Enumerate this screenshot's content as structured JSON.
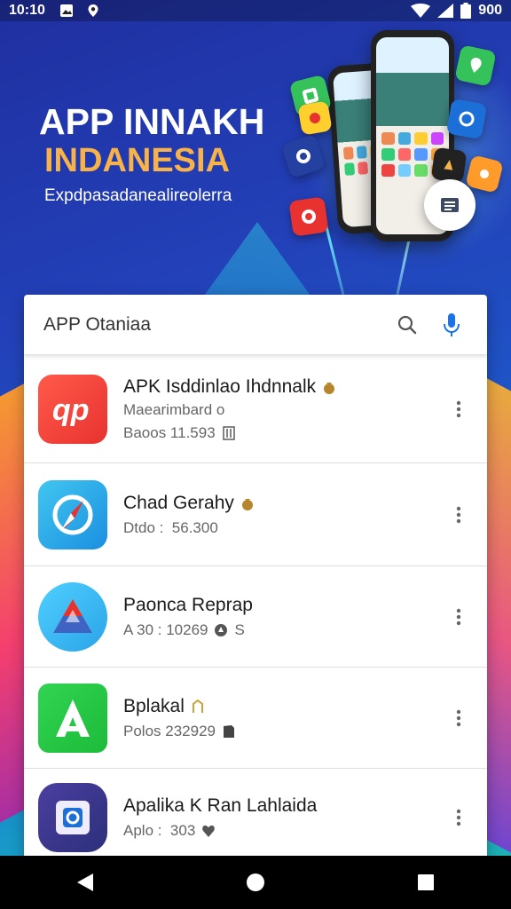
{
  "status_bar": {
    "time": "10:10",
    "battery": "900",
    "icons": [
      "gallery-icon",
      "location-icon",
      "wifi-icon",
      "signal-icon",
      "battery-icon"
    ]
  },
  "hero": {
    "title": "APP INNAKH",
    "subtitle": "INDANESIA",
    "tagline": "Expdpasadanealireolerra"
  },
  "search": {
    "placeholder": "APP Otaniaa"
  },
  "apps": [
    {
      "name": "APK Isddinlao Ihdnnalk",
      "developer": "Maearimbard o",
      "meta": "Baoos 11.593",
      "badge": "coin-bag",
      "meta_icon": "book-icon",
      "icon": "app-logo-red",
      "colors": [
        "#e8322f",
        "#ff5a4a"
      ]
    },
    {
      "name": "Chad Gerahy",
      "developer": "",
      "meta": "Dtdo :  56.300",
      "badge": "coin-bag",
      "meta_icon": "coin-bag",
      "icon": "compass-logo",
      "colors": [
        "#1b8fe0",
        "#41c6f0"
      ]
    },
    {
      "name": "Paonca Reprap",
      "developer": "",
      "meta": "A 30 : 10269",
      "badge": "",
      "meta_icon": "pin-icon",
      "meta_suffix": "S",
      "icon": "triangle-logo",
      "colors": [
        "#2aa3e8",
        "#4fd0ff"
      ]
    },
    {
      "name": "Bplakal",
      "developer": "",
      "meta": "Polos 232929",
      "badge": "gold-mark",
      "meta_icon": "book-icon",
      "icon": "letter-a-logo",
      "colors": [
        "#1dbb3a",
        "#31d452"
      ]
    },
    {
      "name": "Apalika K Ran Lahlaida",
      "developer": "",
      "meta": "Aplo :  303",
      "badge": "",
      "meta_icon": "heart-icon",
      "meta_prefix_icon": "coin-bag",
      "icon": "square-logo",
      "colors": [
        "#2c2f7a",
        "#4b3fa0"
      ]
    }
  ],
  "colors": {
    "card_bg": "#ffffff",
    "accent_blue": "#1a73e8",
    "hero_orange": "#f7b24a"
  }
}
